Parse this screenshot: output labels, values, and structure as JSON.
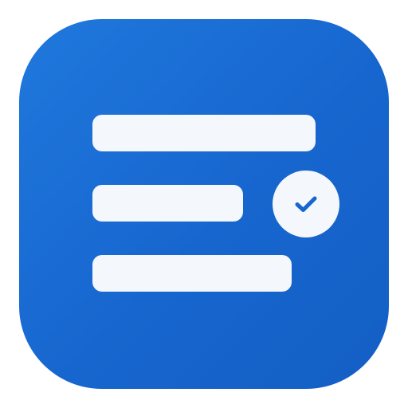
{
  "icon": {
    "name": "checklist-app-icon",
    "background_color": "#1766cf",
    "bar_color": "#f4f7fb",
    "badge_color": "#f4f7fb",
    "check_color": "#1766cf",
    "badge_icon": "check-icon"
  }
}
